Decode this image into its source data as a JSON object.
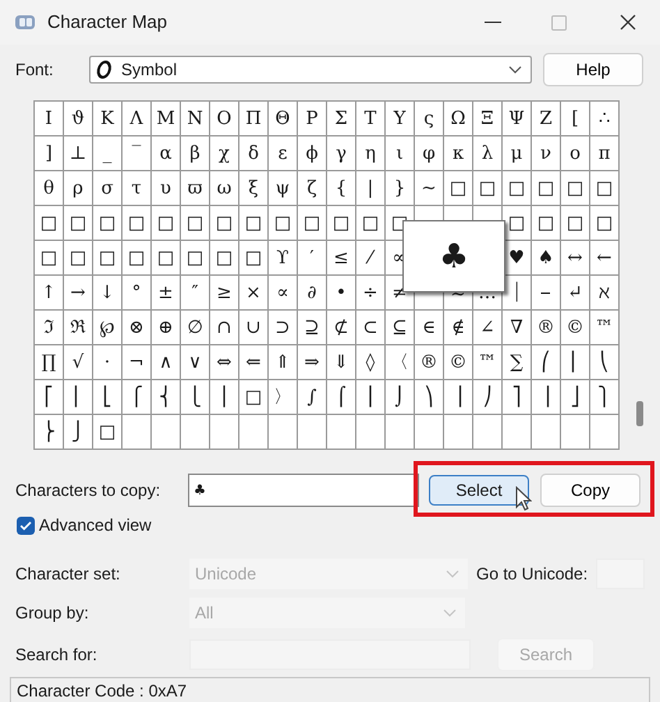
{
  "window": {
    "title": "Character Map"
  },
  "font": {
    "label": "Font:",
    "value": "Symbol"
  },
  "help_button": {
    "label": "Help"
  },
  "grid": {
    "rows": [
      [
        "Ι",
        "ϑ",
        "Κ",
        "Λ",
        "Μ",
        "Ν",
        "Ο",
        "Π",
        "Θ",
        "Ρ",
        "Σ",
        "Τ",
        "Υ",
        "ς",
        "Ω",
        "Ξ",
        "Ψ",
        "Ζ",
        "[",
        "∴"
      ],
      [
        "]",
        "⊥",
        "_",
        "‾",
        "α",
        "β",
        "χ",
        "δ",
        "ε",
        "ϕ",
        "γ",
        "η",
        "ι",
        "φ",
        "κ",
        "λ",
        "μ",
        "ν",
        "ο",
        "π"
      ],
      [
        "θ",
        "ρ",
        "σ",
        "τ",
        "υ",
        "ϖ",
        "ω",
        "ξ",
        "ψ",
        "ζ",
        "{",
        "|",
        "}",
        "~",
        "□",
        "□",
        "□",
        "□",
        "□",
        "□"
      ],
      [
        "□",
        "□",
        "□",
        "□",
        "□",
        "□",
        "□",
        "□",
        "□",
        "□",
        "□",
        "□",
        "□",
        null,
        null,
        null,
        "□",
        "□",
        "□",
        "□"
      ],
      [
        "□",
        "□",
        "□",
        "□",
        "□",
        "□",
        "□",
        "□",
        "ϒ",
        "′",
        "≤",
        "⁄",
        "∞",
        null,
        null,
        null,
        "♥",
        "♠",
        "↔",
        "←"
      ],
      [
        "↑",
        "→",
        "↓",
        "°",
        "±",
        "″",
        "≥",
        "×",
        "∝",
        "∂",
        "•",
        "÷",
        "≠",
        null,
        "≈",
        "…",
        "⏐",
        "⎯",
        "↵",
        "ℵ"
      ],
      [
        "ℑ",
        "ℜ",
        "℘",
        "⊗",
        "⊕",
        "∅",
        "∩",
        "∪",
        "⊃",
        "⊇",
        "⊄",
        "⊂",
        "⊆",
        "∈",
        "∉",
        "∠",
        "∇",
        "®",
        "©",
        "™"
      ],
      [
        "∏",
        "√",
        "⋅",
        "¬",
        "∧",
        "∨",
        "⇔",
        "⇐",
        "⇑",
        "⇒",
        "⇓",
        "◊",
        "〈",
        "®",
        "©",
        "™",
        "∑",
        "⎛",
        "⎜",
        "⎝"
      ],
      [
        "⎡",
        "⎢",
        "⎣",
        "⎧",
        "⎨",
        "⎩",
        "⎪",
        "□",
        "〉",
        "∫",
        "⌠",
        "⎮",
        "⌡",
        "⎞",
        "⎟",
        "⎠",
        "⎤",
        "⎥",
        "⎦",
        "⎫"
      ],
      [
        "⎬",
        "⎭",
        "□",
        null,
        null,
        null,
        null,
        null,
        null,
        null,
        null,
        null,
        null,
        null,
        null,
        null,
        null,
        null,
        null,
        null
      ]
    ]
  },
  "popup": {
    "char": "♣"
  },
  "characters_to_copy": {
    "label": "Characters to copy:",
    "value": "♣"
  },
  "select_button": {
    "label": "Select"
  },
  "copy_button": {
    "label": "Copy"
  },
  "advanced_view": {
    "label": "Advanced view",
    "checked": true
  },
  "character_set": {
    "label": "Character set:",
    "value": "Unicode",
    "disabled": true
  },
  "go_to_unicode": {
    "label": "Go to Unicode:",
    "disabled": true
  },
  "group_by": {
    "label": "Group by:",
    "value": "All",
    "disabled": true
  },
  "search_for": {
    "label": "Search for:",
    "disabled": true
  },
  "search_button": {
    "label": "Search",
    "disabled": true
  },
  "status_bar": {
    "text": "Character Code : 0xA7"
  }
}
